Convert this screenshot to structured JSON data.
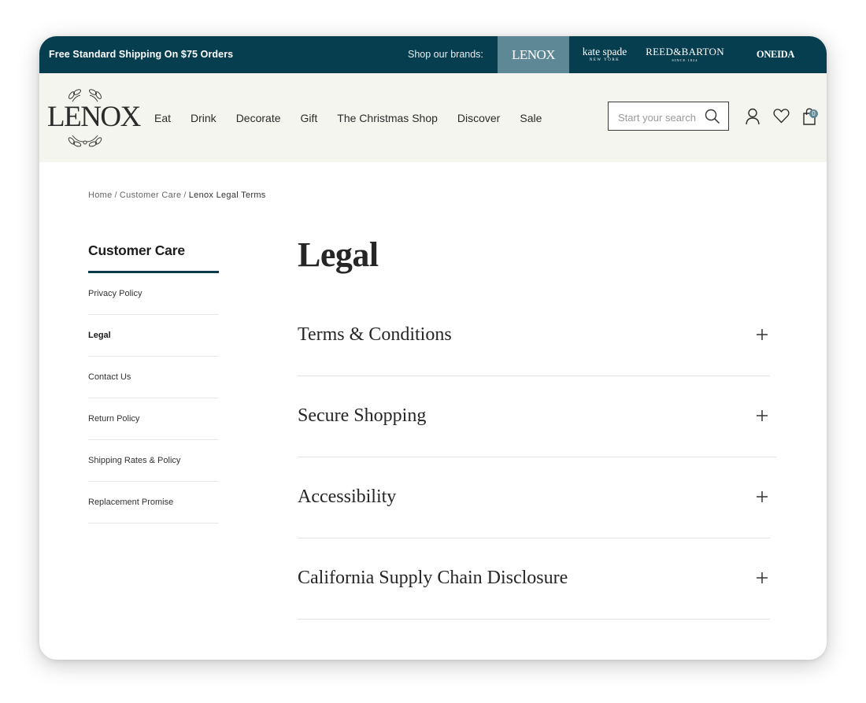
{
  "topbar": {
    "promo": "Free Standard Shipping On $75 Orders",
    "brands_label": "Shop our brands:",
    "brands": {
      "lenox": "LENOX",
      "kate": "kate spade",
      "kate_sub": "NEW YORK",
      "reed": "REED&BARTON",
      "reed_sub": "SINCE 1824",
      "oneida": "ONEIDA"
    }
  },
  "header": {
    "logo": "LENOX",
    "nav": [
      "Eat",
      "Drink",
      "Decorate",
      "Gift",
      "The Christmas Shop",
      "Discover",
      "Sale"
    ],
    "search_placeholder": "Start your search",
    "cart_count": "0"
  },
  "breadcrumb": [
    "Home",
    "Customer Care",
    "Lenox Legal Terms"
  ],
  "sidebar": {
    "title": "Customer Care",
    "items": [
      "Privacy Policy",
      "Legal",
      "Contact Us",
      "Return Policy",
      "Shipping Rates & Policy",
      "Replacement Promise"
    ],
    "active_index": 1
  },
  "main": {
    "title": "Legal",
    "sections": [
      "Terms & Conditions",
      "Secure Shopping",
      "Accessibility",
      "California Supply Chain Disclosure"
    ]
  },
  "colors": {
    "topbar": "#063d4f",
    "brand_highlight": "#5f8896",
    "header_bg": "#f5f5ef",
    "accent_rule": "#0b3a4a"
  }
}
